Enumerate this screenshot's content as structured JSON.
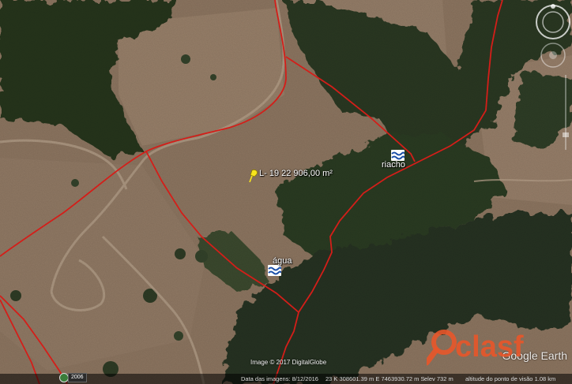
{
  "placemarks": {
    "area": {
      "label": "L- 19 22 906,00 m²",
      "icon": "pushpin-icon"
    },
    "riacho": {
      "label": "riacho",
      "icon": "water-icon"
    },
    "agua": {
      "label": "água",
      "icon": "water-icon"
    }
  },
  "credits": {
    "imagery": "Image © 2017 DigitalGlobe",
    "logo": "Google Earth"
  },
  "status_bar": {
    "imagery_date": "Data das imagens: 8/12/2016",
    "coordinates": "23 K 308601.39 m E 7463930.72 m S",
    "elevation": "elev  732 m",
    "eye_altitude": "altitude do ponto de visão  1.08 km",
    "year_badge": "2006"
  },
  "watermark": {
    "text": "clasf",
    "icon": "magnifier-icon"
  },
  "colors": {
    "boundary": "#e0201b",
    "forest_dark": "#26341f",
    "forest_mid": "#3a4a2c",
    "pasture": "#8c7560",
    "pasture_light": "#a08a74",
    "watermark": "#e8562a"
  }
}
